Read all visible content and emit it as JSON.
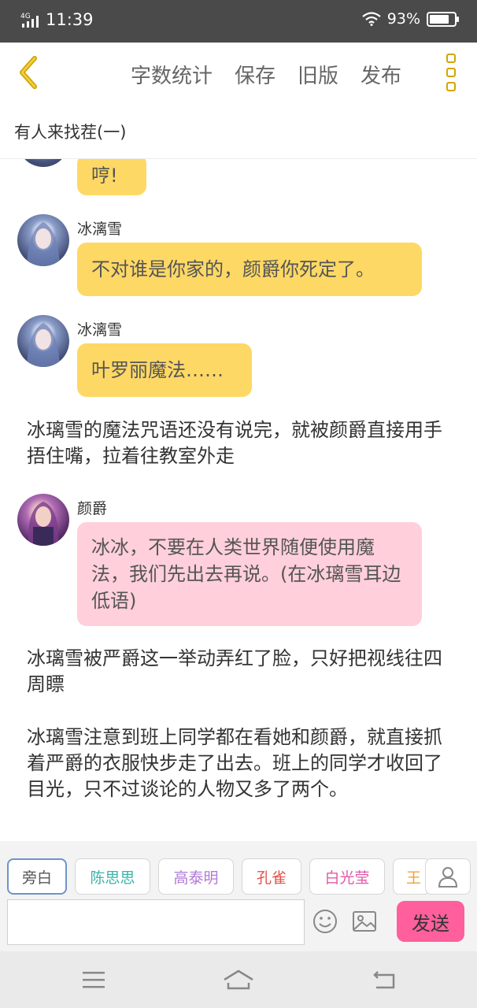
{
  "status_bar": {
    "network": "4G",
    "time": "11:39",
    "battery_pct": "93%",
    "battery_level": 0.93
  },
  "toolbar": {
    "actions": [
      "字数统计",
      "保存",
      "旧版",
      "发布"
    ],
    "accent_color": "#d4a500"
  },
  "chapter": {
    "title": "有人来找茬(一)"
  },
  "messages": [
    {
      "type": "bubble",
      "speaker": "",
      "text": "哼!",
      "color": "#fdd865"
    },
    {
      "type": "bubble",
      "speaker": "冰漓雪",
      "text": "不对谁是你家的，颜爵你死定了。",
      "color": "#fdd865"
    },
    {
      "type": "bubble",
      "speaker": "冰漓雪",
      "text": "叶罗丽魔法……",
      "color": "#fdd865"
    },
    {
      "type": "narration",
      "text": "冰璃雪的魔法咒语还没有说完，就被颜爵直接用手捂住嘴，拉着往教室外走"
    },
    {
      "type": "bubble",
      "speaker": "颜爵",
      "text": "冰冰，不要在人类世界随便使用魔法，我们先出去再说。(在冰璃雪耳边低语)",
      "color": "#ffd0db"
    },
    {
      "type": "narration",
      "text": "冰璃雪被严爵这一举动弄红了脸，只好把视线往四周瞟"
    },
    {
      "type": "narration",
      "text": "冰璃雪注意到班上同学都在看她和颜爵，就直接抓着严爵的衣服快步走了出去。班上的同学才收回了目光，只不过谈论的人物又多了两个。"
    }
  ],
  "roles": [
    {
      "label": "旁白",
      "color": "#555555",
      "active": true
    },
    {
      "label": "陈思思",
      "color": "#3bb3a8",
      "active": false
    },
    {
      "label": "高泰明",
      "color": "#b07ad6",
      "active": false
    },
    {
      "label": "孔雀",
      "color": "#e0524a",
      "active": false
    },
    {
      "label": "白光莹",
      "color": "#e05aa8",
      "active": false
    },
    {
      "label": "王",
      "color": "#f0a040",
      "active": false
    }
  ],
  "composer": {
    "input_value": "",
    "send_label": "发送",
    "send_color": "#ff5f9c"
  }
}
